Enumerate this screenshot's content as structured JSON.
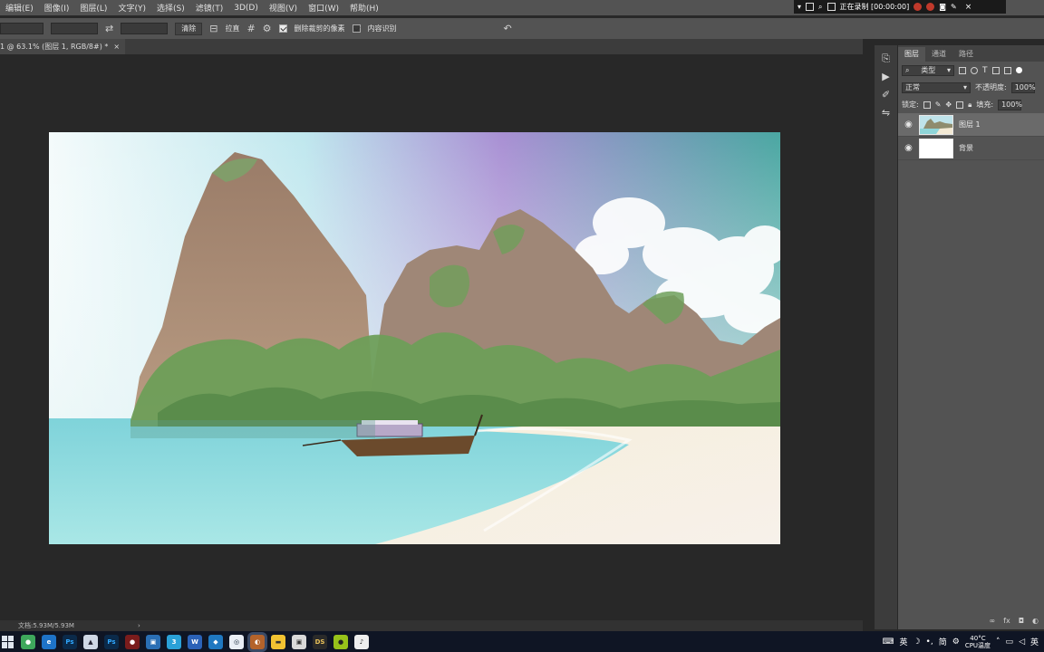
{
  "menubar": {
    "items": [
      "编辑(E)",
      "图像(I)",
      "图层(L)",
      "文字(Y)",
      "选择(S)",
      "滤镜(T)",
      "3D(D)",
      "视图(V)",
      "窗口(W)",
      "帮助(H)"
    ]
  },
  "recorder": {
    "status": "正在录制 [00:00:00]"
  },
  "options": {
    "button_label": "清除",
    "straighten_label": "拉直",
    "delete_cropped_label": "删除裁剪的像素",
    "content_aware_label": "内容识别"
  },
  "document": {
    "tab_title": "1 @ 63.1% (图层 1, RGB/8#) *",
    "tab_close": "×",
    "status_text": "文档:5.93M/5.93M",
    "status_arrow": "›"
  },
  "layers_panel": {
    "tabs": [
      "图层",
      "通道",
      "路径"
    ],
    "active_tab": 0,
    "kind_filter": "类型",
    "blend_mode": "正常",
    "opacity_label": "不透明度:",
    "opacity_value": "100%",
    "lock_label": "锁定:",
    "fill_label": "填充:",
    "fill_value": "100%",
    "layers": [
      {
        "name": "图层 1",
        "visible": true,
        "selected": true
      },
      {
        "name": "背景",
        "visible": true,
        "selected": false
      }
    ]
  },
  "taskbar": {
    "tray_ime": "英",
    "tray_chinese": "简",
    "cpu_temp": "40°C",
    "cpu_label": "CPU温度",
    "lang": "英"
  },
  "colors": {
    "sky_top": "#e8f4f6",
    "sky_purple": "#a890d0",
    "sea": "#6fd0d0",
    "sand": "#f2e6cf",
    "mountain": "#a8866e",
    "forest": "#6f9f5a"
  }
}
